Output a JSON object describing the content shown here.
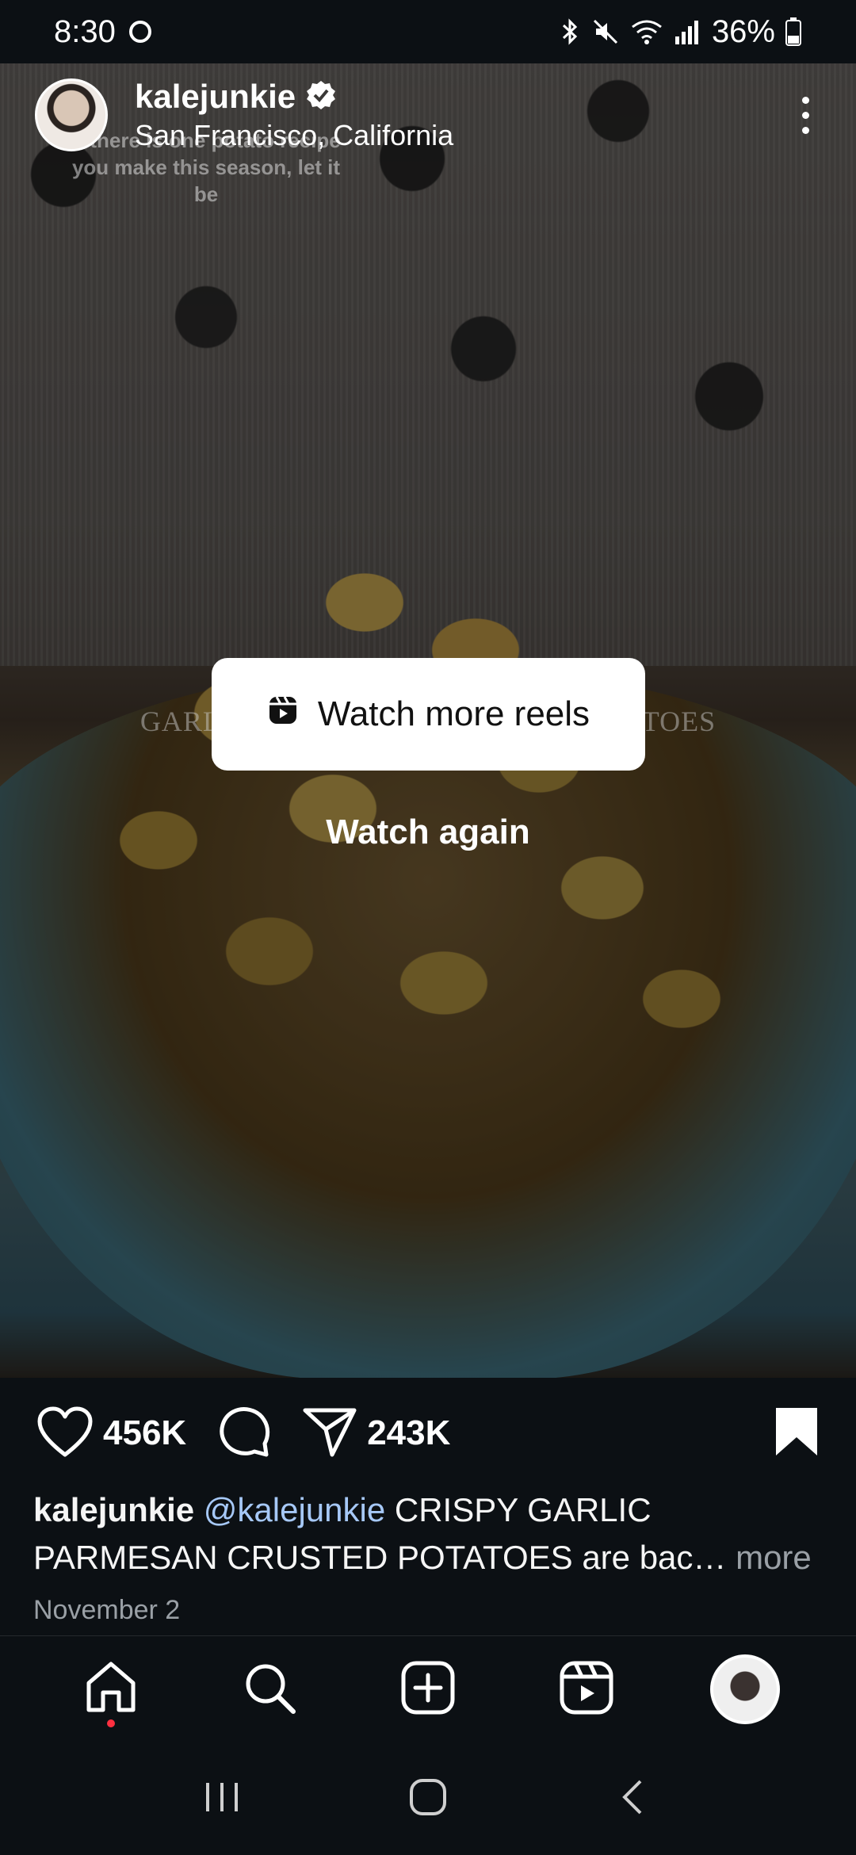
{
  "status_bar": {
    "time": "8:30",
    "battery": "36%"
  },
  "post": {
    "username": "kalejunkie",
    "location": "San Francisco, California",
    "verified": true,
    "overlay_text": "If there is one potato recipe you make this season, let it be",
    "video_title": "GARLIC PARMESAN CRUSTED POTATOES",
    "watch_more_label": "Watch more reels",
    "watch_again_label": "Watch again",
    "likes": "456K",
    "shares": "243K",
    "caption": {
      "user": "kalejunkie",
      "mention": "@kalejunkie",
      "text": " CRISPY GARLIC PARMESAN CRUSTED POTATOES are bac…",
      "more": " more"
    },
    "date": "November 2"
  },
  "colors": {
    "background": "#0c1014",
    "mention": "#a6c8f7",
    "notification_dot": "#ff3040",
    "verified_badge": "#ffffff"
  },
  "icons": {
    "like": "heart-icon",
    "comment": "comment-icon",
    "share": "send-icon",
    "save": "bookmark-icon"
  }
}
